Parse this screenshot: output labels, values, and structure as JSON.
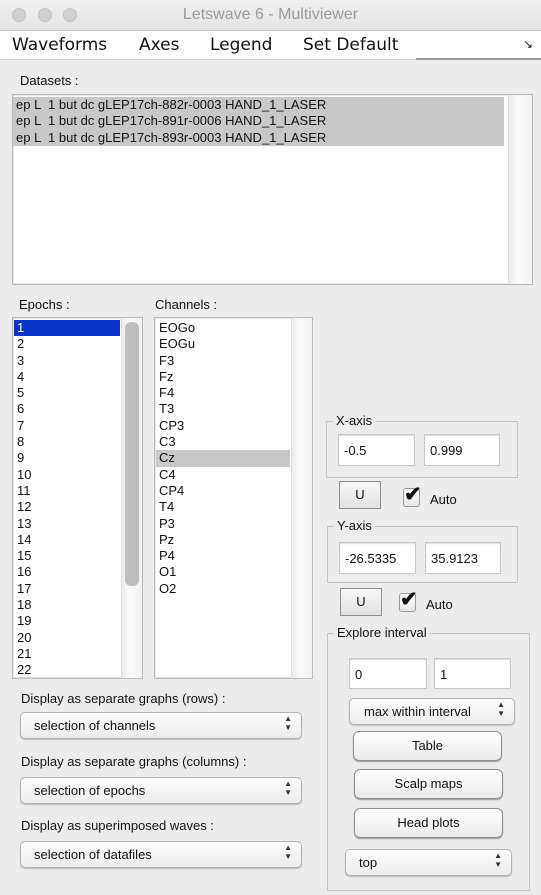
{
  "window": {
    "title": "Letswave 6 - Multiviewer"
  },
  "menubar": {
    "items": [
      "Waveforms",
      "Axes",
      "Legend",
      "Set Default"
    ],
    "overflow_icon": "resize-arrow-icon"
  },
  "datasets": {
    "label": "Datasets :",
    "items": [
      "ep L  1 but dc gLEP17ch-882r-0003 HAND_1_LASER",
      "ep L  1 but dc gLEP17ch-891r-0006 HAND_1_LASER",
      "ep L  1 but dc gLEP17ch-893r-0003 HAND_1_LASER"
    ],
    "selected": [
      0,
      1,
      2
    ]
  },
  "epochs": {
    "label": "Epochs :",
    "items": [
      "1",
      "2",
      "3",
      "4",
      "5",
      "6",
      "7",
      "8",
      "9",
      "10",
      "11",
      "12",
      "13",
      "14",
      "15",
      "16",
      "17",
      "18",
      "19",
      "20",
      "21",
      "22"
    ],
    "selected": [
      0
    ]
  },
  "channels": {
    "label": "Channels :",
    "items": [
      "EOGo",
      "EOGu",
      "F3",
      "Fz",
      "F4",
      "T3",
      "CP3",
      "C3",
      "Cz",
      "C4",
      "CP4",
      "T4",
      "P3",
      "Pz",
      "P4",
      "O1",
      "O2"
    ],
    "selected": [
      8
    ]
  },
  "display": {
    "rows_label": "Display as separate graphs (rows) :",
    "rows_value": "selection of channels",
    "columns_label": "Display as separate graphs (columns) :",
    "columns_value": "selection of epochs",
    "superimposed_label": "Display as superimposed waves :",
    "superimposed_value": "selection of datafiles"
  },
  "xaxis": {
    "legend": "X-axis",
    "min": "-0.5",
    "max": "0.999",
    "u_label": "U",
    "auto_label": "Auto",
    "auto_checked": true
  },
  "yaxis": {
    "legend": "Y-axis",
    "min": "-26.5335",
    "max": "35.9123",
    "u_label": "U",
    "auto_label": "Auto",
    "auto_checked": true
  },
  "explore": {
    "legend": "Explore interval",
    "start": "0",
    "end": "1",
    "mode_value": "max within interval",
    "table_label": "Table",
    "scalp_label": "Scalp maps",
    "head_label": "Head plots",
    "position_value": "top"
  },
  "icons": {
    "checkmark": "✔",
    "popup_arrows": "▲▼"
  }
}
